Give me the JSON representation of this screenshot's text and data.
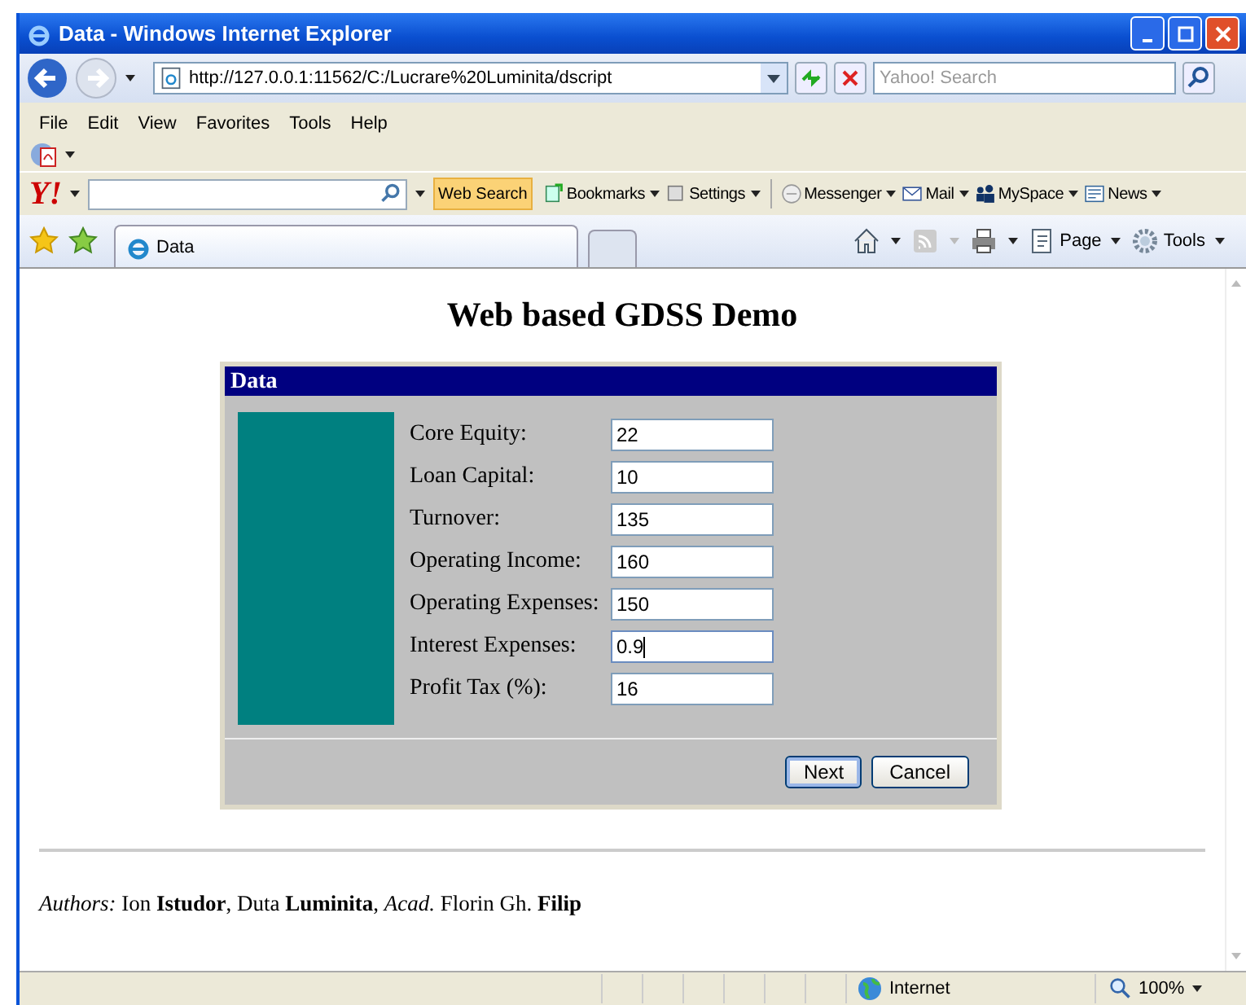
{
  "window": {
    "title": "Data - Windows Internet Explorer"
  },
  "address": {
    "url": "http://127.0.0.1:11562/C:/Lucrare%20Luminita/dscript"
  },
  "search": {
    "placeholder": "Yahoo! Search"
  },
  "menu": [
    "File",
    "Edit",
    "View",
    "Favorites",
    "Tools",
    "Help"
  ],
  "yahoo_toolbar": {
    "logo": "Y!",
    "search_button": "Web Search",
    "items": [
      {
        "label": "Bookmarks",
        "kind": "bookmarks"
      },
      {
        "label": "Settings",
        "kind": "settings"
      },
      {
        "label": "Messenger",
        "kind": "messenger"
      },
      {
        "label": "Mail",
        "kind": "mail"
      },
      {
        "label": "MySpace",
        "kind": "people"
      },
      {
        "label": "News",
        "kind": "news"
      }
    ]
  },
  "tabs": [
    {
      "label": "Data",
      "selected": true
    }
  ],
  "command_bar": [
    {
      "label": "Page",
      "kind": "page"
    },
    {
      "label": "Tools",
      "kind": "gear"
    }
  ],
  "page": {
    "heading": "Web based GDSS Demo",
    "dialog": {
      "title": "Data",
      "fields": [
        {
          "label": "Core Equity:",
          "value": "22",
          "focused": false
        },
        {
          "label": "Loan Capital:",
          "value": "10",
          "focused": false
        },
        {
          "label": "Turnover:",
          "value": "135",
          "focused": false
        },
        {
          "label": "Operating Income:",
          "value": "160",
          "focused": false
        },
        {
          "label": "Operating Expenses:",
          "value": "150",
          "focused": false
        },
        {
          "label": "Interest Expenses:",
          "value": "0.9",
          "focused": true
        },
        {
          "label": "Profit Tax (%):",
          "value": "16",
          "focused": false
        }
      ],
      "buttons": [
        {
          "label": "Next",
          "selected": true
        },
        {
          "label": "Cancel",
          "selected": false
        }
      ]
    },
    "authors": "*Authors:* Ion **Istudor**, Duta **Luminita**, *Acad.* Florin Gh. **Filip**"
  },
  "status_bar": {
    "zone": "Internet",
    "zoom": "100%"
  }
}
